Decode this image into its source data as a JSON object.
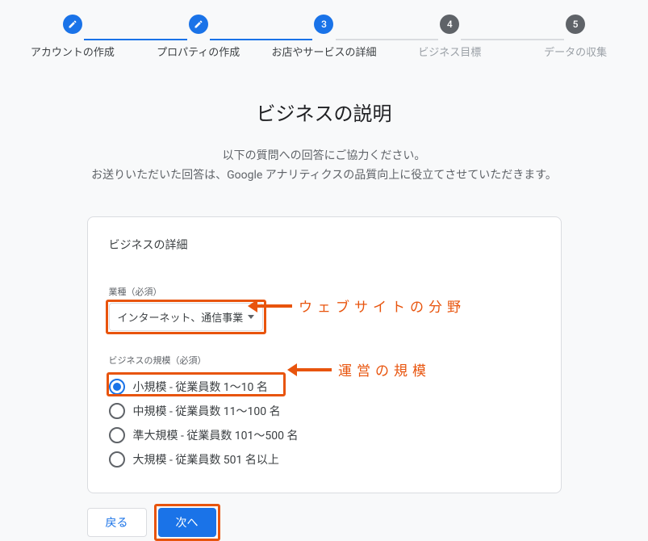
{
  "stepper": {
    "steps": [
      {
        "label": "アカウントの作成",
        "state": "done"
      },
      {
        "label": "プロパティの作成",
        "state": "done"
      },
      {
        "label": "お店やサービスの詳細",
        "state": "active",
        "num": "3"
      },
      {
        "label": "ビジネス目標",
        "state": "inactive",
        "num": "4"
      },
      {
        "label": "データの収集",
        "state": "inactive",
        "num": "5"
      }
    ]
  },
  "header": {
    "title": "ビジネスの説明",
    "desc_line1": "以下の質問への回答にご協力ください。",
    "desc_line2": "お送りいただいた回答は、Google アナリティクスの品質向上に役立てさせていただきます。"
  },
  "card": {
    "title": "ビジネスの詳細",
    "industry_label": "業種（必須）",
    "industry_value": "インターネット、通信事業",
    "size_label": "ビジネスの規模（必須）",
    "size_options": [
      "小規模 - 従業員数 1～10 名",
      "中規模 - 従業員数 11～100 名",
      "準大規模 - 従業員数 101～500 名",
      "大規模 - 従業員数 501 名以上"
    ],
    "size_selected_index": 0
  },
  "annotations": {
    "industry": "ウェブサイトの分野",
    "size": "運営の規模",
    "highlight_color": "#e8540d"
  },
  "buttons": {
    "back": "戻る",
    "next": "次へ"
  }
}
